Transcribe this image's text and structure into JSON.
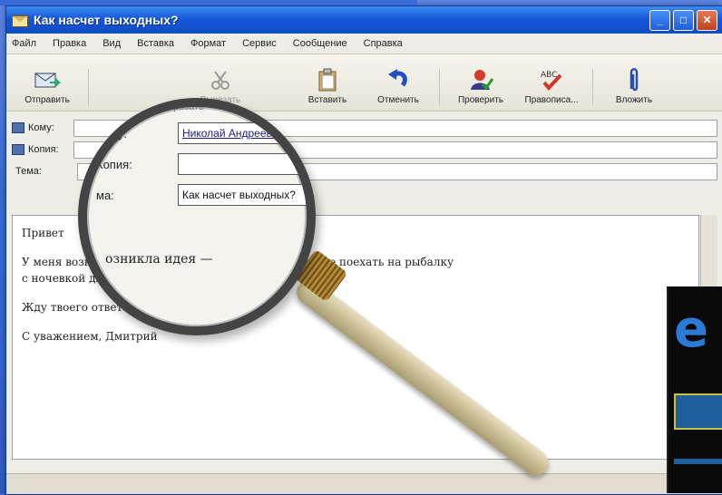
{
  "window": {
    "title": "Как насчет выходных?"
  },
  "menu": [
    "Файл",
    "Правка",
    "Вид",
    "Вставка",
    "Формат",
    "Сервис",
    "Сообщение",
    "Справка"
  ],
  "toolbar": {
    "send": "Отправить",
    "cut": "Вырезать",
    "paste": "Вставить",
    "undo": "Отменить",
    "check": "Проверить",
    "spelling": "Правописа...",
    "attach": "Вложить"
  },
  "headers": {
    "to_label": "Кому:",
    "cc_label": "Копия:",
    "subject_label": "Тема:"
  },
  "lens": {
    "toolbar_fragment": "Вырезать",
    "to_label": "Кому:",
    "to_value": "Николай Андреевич",
    "cc_label": "Копия:",
    "subject_label": "ма:",
    "subject_value": "Как насчет выходных?",
    "body_fragment": "озникла идея —"
  },
  "body": {
    "greeting": "Привет",
    "line1": "У меня возникла идея — ду на этих выходных! Можно поехать на рыбалку",
    "line2": "с ночевкой                                             ды! Присоединяйся!:)",
    "line3": "Жду твоего ответа",
    "signature": "С уважением, Дмитрий"
  },
  "colors": {
    "titlebar": "#1559d8",
    "window_bg": "#efeee6",
    "accent": "#3a6ad6"
  }
}
